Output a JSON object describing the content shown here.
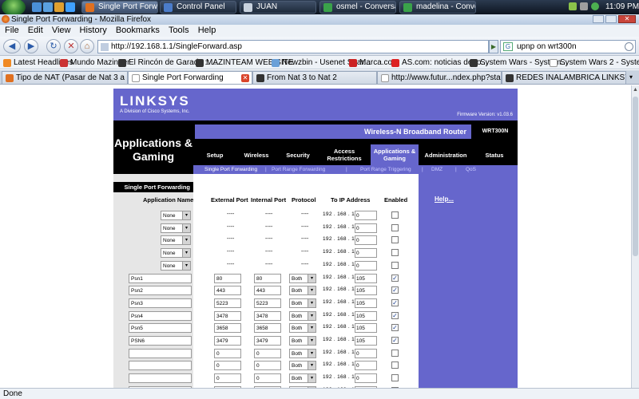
{
  "taskbar": {
    "buttons": [
      {
        "label": "Single Port Forwardi..."
      },
      {
        "label": "Control Panel"
      },
      {
        "label": "JUAN"
      },
      {
        "label": "osmel - Conversation"
      },
      {
        "label": "madelina - Convers..."
      }
    ],
    "clock": "11:09 PM"
  },
  "window": {
    "title": "Single Port Forwarding - Mozilla Firefox"
  },
  "menu": [
    "File",
    "Edit",
    "View",
    "History",
    "Bookmarks",
    "Tools",
    "Help"
  ],
  "nav": {
    "url": "http://192.168.1.1/SingleForward.asp",
    "search_value": "upnp on wrt300n"
  },
  "bookmarks": [
    "Latest Headlines",
    "Mundo Mazinger",
    "El Rincón de Garada :: ...",
    "MAZINTEAM WEB SITE",
    "Newzbin - Usenet Sear...",
    "Marca.com",
    "AS.com: noticias depo...",
    "System Wars - System...",
    "System Wars 2 - Syste..."
  ],
  "tabs": [
    "Tipo de NAT (Pasar de Nat 3 a Nat 2)",
    "Single Port Forwarding",
    "From Nat 3 to Nat 2",
    "http://www.futur...ndex.php?stage=1",
    "REDES INALAMBRICA LINKSYS RO..."
  ],
  "status": "Done",
  "router": {
    "logo": "LINKSYS",
    "logo_sub": "A Division of Cisco Systems, Inc.",
    "firmware": "Firmware Version: v1.03.6",
    "page_title": "Applications & Gaming",
    "product_name": "Wireless-N Broadband Router",
    "model": "WRT300N",
    "nav_tabs": [
      "Setup",
      "Wireless",
      "Security",
      "Access Restrictions",
      "Applications & Gaming",
      "Administration",
      "Status"
    ],
    "sub_tabs": [
      "Single Port Forwarding",
      "Port Range Forwarding",
      "Port Range Triggering",
      "DMZ",
      "QoS"
    ],
    "sub_sep": "|",
    "section": "Single Port Forwarding",
    "help": "Help...",
    "columns": {
      "app": "Application Name",
      "ext": "External Port",
      "int": "Internal Port",
      "proto": "Protocol",
      "ip": "To IP Address",
      "enabled": "Enabled"
    },
    "ip_prefix": "192 . 168 . 1 .",
    "dash": "----",
    "check_mark": "✓",
    "select_arrow": "▾",
    "preset_rows": [
      {
        "app": "None",
        "last_octet": "0",
        "enabled": false
      },
      {
        "app": "None",
        "last_octet": "0",
        "enabled": false
      },
      {
        "app": "None",
        "last_octet": "0",
        "enabled": false
      },
      {
        "app": "None",
        "last_octet": "0",
        "enabled": false
      },
      {
        "app": "None",
        "last_octet": "0",
        "enabled": false
      }
    ],
    "custom_rows": [
      {
        "app": "Psn1",
        "ext": "80",
        "int": "80",
        "proto": "Both",
        "last_octet": "105",
        "enabled": true
      },
      {
        "app": "Psn2",
        "ext": "443",
        "int": "443",
        "proto": "Both",
        "last_octet": "105",
        "enabled": true
      },
      {
        "app": "Psn3",
        "ext": "5223",
        "int": "5223",
        "proto": "Both",
        "last_octet": "105",
        "enabled": true
      },
      {
        "app": "Psn4",
        "ext": "3478",
        "int": "3478",
        "proto": "Both",
        "last_octet": "105",
        "enabled": true
      },
      {
        "app": "Psn5",
        "ext": "3658",
        "int": "3658",
        "proto": "Both",
        "last_octet": "105",
        "enabled": true
      },
      {
        "app": "PSN6",
        "ext": "3479",
        "int": "3479",
        "proto": "Both",
        "last_octet": "105",
        "enabled": true
      },
      {
        "app": "",
        "ext": "0",
        "int": "0",
        "proto": "Both",
        "last_octet": "0",
        "enabled": false
      },
      {
        "app": "",
        "ext": "0",
        "int": "0",
        "proto": "Both",
        "last_octet": "0",
        "enabled": false
      },
      {
        "app": "",
        "ext": "0",
        "int": "0",
        "proto": "Both",
        "last_octet": "0",
        "enabled": false
      },
      {
        "app": "",
        "ext": "0",
        "int": "0",
        "proto": "Both",
        "last_octet": "0",
        "enabled": false
      }
    ]
  }
}
